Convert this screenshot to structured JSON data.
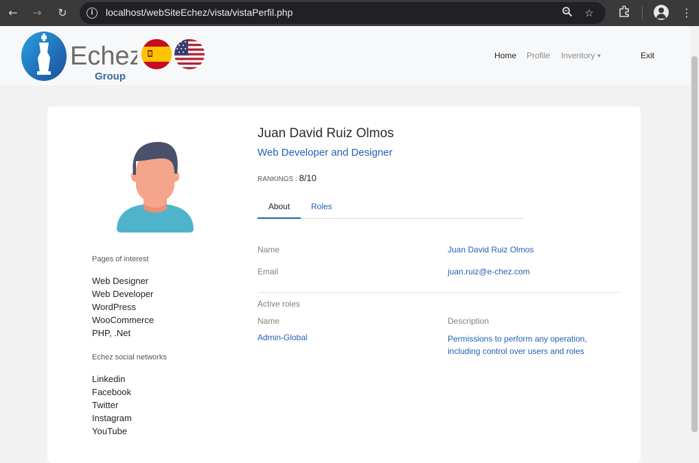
{
  "browser": {
    "url": "localhost/webSiteEchez/vista/vistaPerfil.php"
  },
  "header": {
    "logo_text": "Echez",
    "logo_sub": "Group",
    "nav": {
      "home": "Home",
      "profile": "Profile",
      "inventory": "Inventory",
      "exit": "Exit"
    }
  },
  "sidebar": {
    "interest_title": "Pages of interest",
    "interest_links": [
      "Web Designer",
      "Web Developer",
      "WordPress",
      "WooCommerce",
      "PHP, .Net"
    ],
    "social_title": "Echez social networks",
    "social_links": [
      "Linkedin",
      "Facebook",
      "Twitter",
      "Instagram",
      "YouTube"
    ]
  },
  "profile": {
    "name": "Juan David Ruiz Olmos",
    "title": "Web Developer and Designer",
    "rankings_label": "RANKINGS :",
    "rankings_value": "8/10"
  },
  "tabs": {
    "about": "About",
    "roles": "Roles"
  },
  "about": {
    "name_label": "Name",
    "name_value": "Juan David Ruiz Olmos",
    "email_label": "Email",
    "email_value": "juan.ruiz@e-chez.com"
  },
  "roles": {
    "section_title": "Active roles",
    "col_name": "Name",
    "col_description": "Description",
    "role_name": "Admin-Global",
    "role_description_line1": "Permissions to perform any operation,",
    "role_description_line2": "including control over users and roles"
  },
  "colors": {
    "link_blue": "#1f5fb4",
    "chrome_dark": "#3a3a3a"
  }
}
